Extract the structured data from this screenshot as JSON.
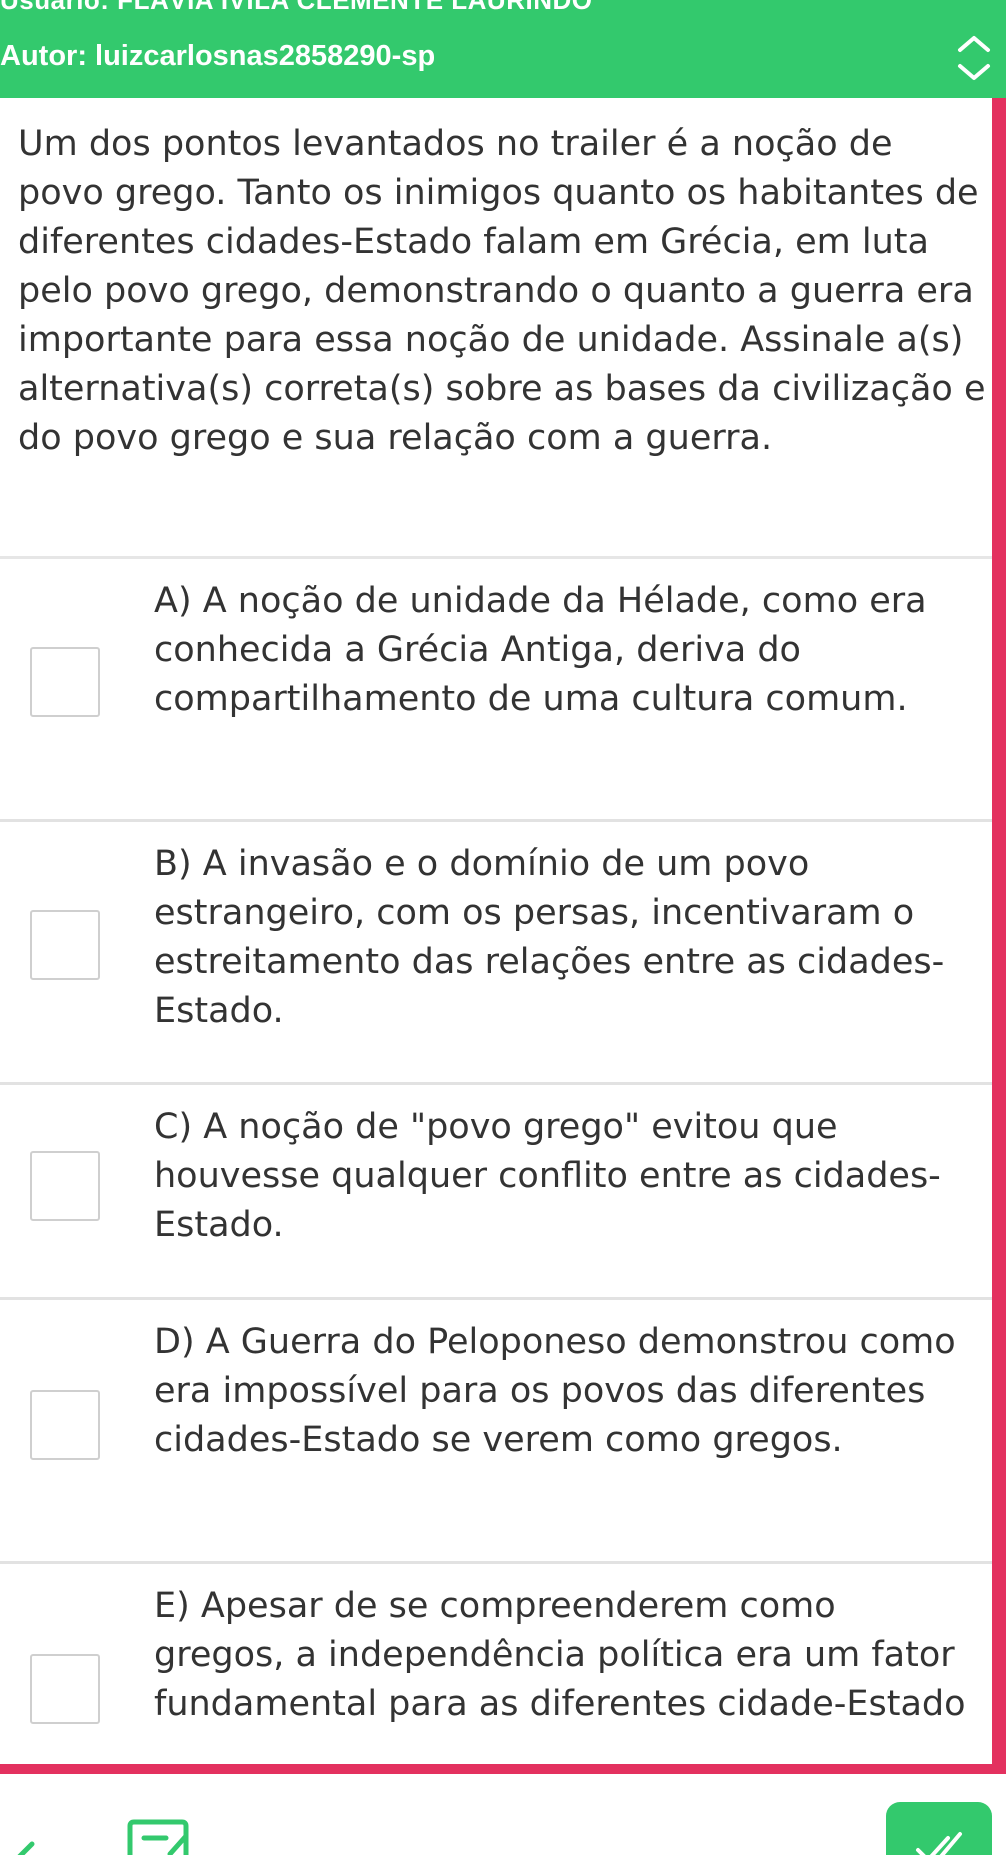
{
  "header": {
    "user_line": "Usuário: FLÁVIA ÍVILA CLEMENTE LAURINDO",
    "author_line": "Autor: luizcarlosnas2858290-sp"
  },
  "question": {
    "text": "Um dos pontos levantados no trailer é a noção de povo grego. Tanto os inimigos quanto os habitantes de diferentes cidades-Estado falam em Grécia, em luta pelo povo grego, demonstrando o quanto a guerra era importante para essa noção de unidade. Assinale a(s) alternativa(s) correta(s) sobre as bases da civilização e do povo grego e sua relação com a guerra."
  },
  "options": [
    {
      "text": "A) A noção de unidade da Hélade, como era conhecida a Grécia Antiga, deriva do compartilhamento de uma cultura comum."
    },
    {
      "text": "B) A invasão e o domínio de um povo estrangeiro, com os persas, incentivaram o estreitamento das relações entre as cidades-Estado."
    },
    {
      "text": "C) A noção de \"povo grego\" evitou que houvesse qualquer conflito entre as cidades-Estado."
    },
    {
      "text": "D) A Guerra do Peloponeso demonstrou como era impossível para os povos das diferentes cidades-Estado se verem como gregos."
    },
    {
      "text": "E) Apesar de se compreenderem como gregos, a independência política era um fator fundamental para as diferentes cidade-Estado"
    }
  ],
  "colors": {
    "brand_green": "#33c96d",
    "accent_magenta": "#e3315f"
  },
  "icons": {
    "header_toggle": "chevron-up-down-icon",
    "back": "arrow-left-icon",
    "notes": "notes-edit-icon",
    "confirm": "double-check-icon"
  }
}
